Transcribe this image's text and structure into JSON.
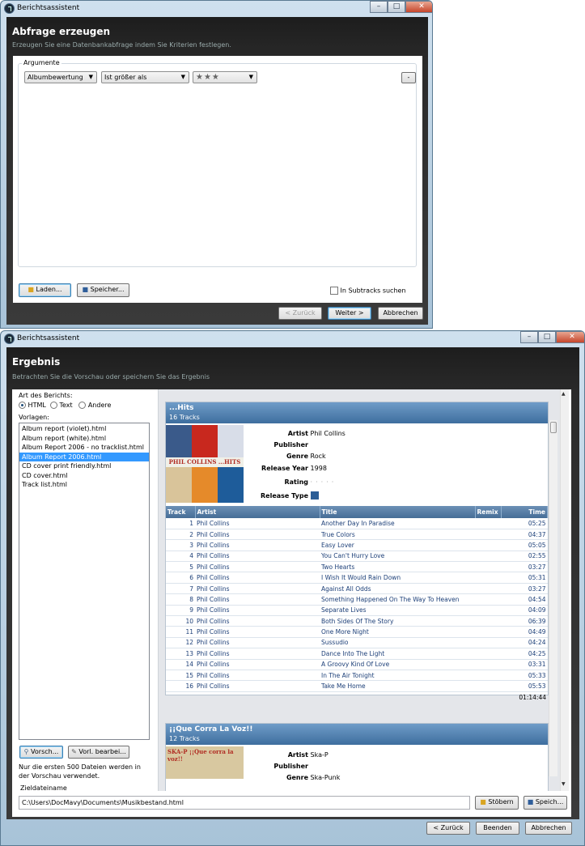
{
  "w1": {
    "title": "Berichtsassistent",
    "header_title": "Abfrage erzeugen",
    "header_sub": "Erzeugen Sie eine Datenbankabfrage indem Sie Kriterien festlegen.",
    "group_label": "Argumente",
    "combo_field": "Albumbewertung",
    "combo_op": "Ist größer als",
    "combo_value": "★★★",
    "remove_label": "-",
    "load_label": "Laden...",
    "save_label": "Speicher...",
    "subtracks_label": "In Subtracks suchen",
    "back_label": "< Zurück",
    "next_label": "Weiter >",
    "cancel_label": "Abbrechen"
  },
  "w2": {
    "title": "Berichtsassistent",
    "header_title": "Ergebnis",
    "header_sub": "Betrachten Sie die Vorschau oder speichern Sie das Ergebnis",
    "type_label": "Art des Berichts:",
    "radio_html": "HTML",
    "radio_text": "Text",
    "radio_other": "Andere",
    "templates_label": "Vorlagen:",
    "templates": [
      "Album report (violet).html",
      "Album report (white).html",
      "Album Report 2006 - no tracklist.html",
      "Album Report 2006.html",
      "CD cover print friendly.html",
      "CD cover.html",
      "Track list.html"
    ],
    "preview_label": "Vorsch...",
    "edit_label": "Vorl. bearbei...",
    "note": "Nur die ersten 500 Dateien werden in der Vorschau verwendet.",
    "target_label": "Zieldateiname",
    "target_path": "C:\\Users\\DocMavy\\Documents\\Musikbestand.html",
    "browse_label": "Stöbern",
    "save_label": "Speich...",
    "back_label": "< Zurück",
    "finish_label": "Beenden",
    "cancel_label": "Abbrechen"
  },
  "album1": {
    "title": "...Hits",
    "tracks": "16 Tracks",
    "artist_k": "Artist",
    "artist_v": "Phil Collins",
    "publisher_k": "Publisher",
    "publisher_v": "",
    "genre_k": "Genre",
    "genre_v": "Rock",
    "year_k": "Release Year",
    "year_v": "1998",
    "rating_k": "Rating",
    "type_k": "Release Type",
    "cover_text": "PHIL COLLINS ...HITS",
    "cols": [
      "Track",
      "Artist",
      "Title",
      "Remix",
      "Time"
    ],
    "rows": [
      [
        "1",
        "Phil Collins",
        "Another Day In Paradise",
        "05:25"
      ],
      [
        "2",
        "Phil Collins",
        "True Colors",
        "04:37"
      ],
      [
        "3",
        "Phil Collins",
        "Easy Lover",
        "05:05"
      ],
      [
        "4",
        "Phil Collins",
        "You Can't Hurry Love",
        "02:55"
      ],
      [
        "5",
        "Phil Collins",
        "Two Hearts",
        "03:27"
      ],
      [
        "6",
        "Phil Collins",
        "I Wish It Would Rain Down",
        "05:31"
      ],
      [
        "7",
        "Phil Collins",
        "Against All Odds",
        "03:27"
      ],
      [
        "8",
        "Phil Collins",
        "Something Happened On The Way To Heaven",
        "04:54"
      ],
      [
        "9",
        "Phil Collins",
        "Separate Lives",
        "04:09"
      ],
      [
        "10",
        "Phil Collins",
        "Both Sides Of The Story",
        "06:39"
      ],
      [
        "11",
        "Phil Collins",
        "One More Night",
        "04:49"
      ],
      [
        "12",
        "Phil Collins",
        "Sussudio",
        "04:24"
      ],
      [
        "13",
        "Phil Collins",
        "Dance Into The Light",
        "04:25"
      ],
      [
        "14",
        "Phil Collins",
        "A Groovy Kind Of Love",
        "03:31"
      ],
      [
        "15",
        "Phil Collins",
        "In The Air Tonight",
        "05:33"
      ],
      [
        "16",
        "Phil Collins",
        "Take Me Home",
        "05:53"
      ]
    ],
    "total": "01:14:44"
  },
  "album2": {
    "title": "¡¡Que Corra La Voz!!",
    "tracks": "12 Tracks",
    "artist_k": "Artist",
    "artist_v": "Ska-P",
    "publisher_k": "Publisher",
    "genre_k": "Genre",
    "genre_v": "Ska-Punk",
    "cover_text": "SKA-P ¡¡Que corra la voz!!"
  }
}
